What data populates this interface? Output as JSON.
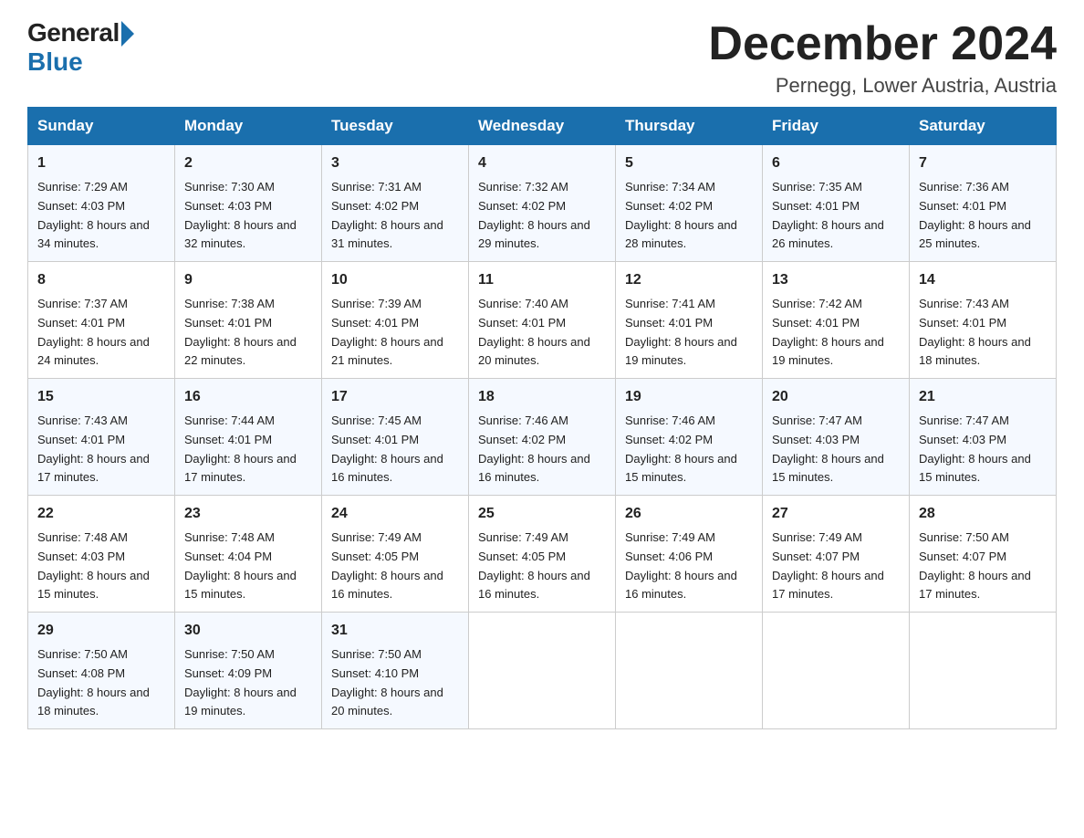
{
  "logo": {
    "general": "General",
    "blue": "Blue"
  },
  "title": "December 2024",
  "location": "Pernegg, Lower Austria, Austria",
  "days_of_week": [
    "Sunday",
    "Monday",
    "Tuesday",
    "Wednesday",
    "Thursday",
    "Friday",
    "Saturday"
  ],
  "weeks": [
    [
      {
        "day": 1,
        "sunrise": "7:29 AM",
        "sunset": "4:03 PM",
        "daylight": "8 hours and 34 minutes."
      },
      {
        "day": 2,
        "sunrise": "7:30 AM",
        "sunset": "4:03 PM",
        "daylight": "8 hours and 32 minutes."
      },
      {
        "day": 3,
        "sunrise": "7:31 AM",
        "sunset": "4:02 PM",
        "daylight": "8 hours and 31 minutes."
      },
      {
        "day": 4,
        "sunrise": "7:32 AM",
        "sunset": "4:02 PM",
        "daylight": "8 hours and 29 minutes."
      },
      {
        "day": 5,
        "sunrise": "7:34 AM",
        "sunset": "4:02 PM",
        "daylight": "8 hours and 28 minutes."
      },
      {
        "day": 6,
        "sunrise": "7:35 AM",
        "sunset": "4:01 PM",
        "daylight": "8 hours and 26 minutes."
      },
      {
        "day": 7,
        "sunrise": "7:36 AM",
        "sunset": "4:01 PM",
        "daylight": "8 hours and 25 minutes."
      }
    ],
    [
      {
        "day": 8,
        "sunrise": "7:37 AM",
        "sunset": "4:01 PM",
        "daylight": "8 hours and 24 minutes."
      },
      {
        "day": 9,
        "sunrise": "7:38 AM",
        "sunset": "4:01 PM",
        "daylight": "8 hours and 22 minutes."
      },
      {
        "day": 10,
        "sunrise": "7:39 AM",
        "sunset": "4:01 PM",
        "daylight": "8 hours and 21 minutes."
      },
      {
        "day": 11,
        "sunrise": "7:40 AM",
        "sunset": "4:01 PM",
        "daylight": "8 hours and 20 minutes."
      },
      {
        "day": 12,
        "sunrise": "7:41 AM",
        "sunset": "4:01 PM",
        "daylight": "8 hours and 19 minutes."
      },
      {
        "day": 13,
        "sunrise": "7:42 AM",
        "sunset": "4:01 PM",
        "daylight": "8 hours and 19 minutes."
      },
      {
        "day": 14,
        "sunrise": "7:43 AM",
        "sunset": "4:01 PM",
        "daylight": "8 hours and 18 minutes."
      }
    ],
    [
      {
        "day": 15,
        "sunrise": "7:43 AM",
        "sunset": "4:01 PM",
        "daylight": "8 hours and 17 minutes."
      },
      {
        "day": 16,
        "sunrise": "7:44 AM",
        "sunset": "4:01 PM",
        "daylight": "8 hours and 17 minutes."
      },
      {
        "day": 17,
        "sunrise": "7:45 AM",
        "sunset": "4:01 PM",
        "daylight": "8 hours and 16 minutes."
      },
      {
        "day": 18,
        "sunrise": "7:46 AM",
        "sunset": "4:02 PM",
        "daylight": "8 hours and 16 minutes."
      },
      {
        "day": 19,
        "sunrise": "7:46 AM",
        "sunset": "4:02 PM",
        "daylight": "8 hours and 15 minutes."
      },
      {
        "day": 20,
        "sunrise": "7:47 AM",
        "sunset": "4:03 PM",
        "daylight": "8 hours and 15 minutes."
      },
      {
        "day": 21,
        "sunrise": "7:47 AM",
        "sunset": "4:03 PM",
        "daylight": "8 hours and 15 minutes."
      }
    ],
    [
      {
        "day": 22,
        "sunrise": "7:48 AM",
        "sunset": "4:03 PM",
        "daylight": "8 hours and 15 minutes."
      },
      {
        "day": 23,
        "sunrise": "7:48 AM",
        "sunset": "4:04 PM",
        "daylight": "8 hours and 15 minutes."
      },
      {
        "day": 24,
        "sunrise": "7:49 AM",
        "sunset": "4:05 PM",
        "daylight": "8 hours and 16 minutes."
      },
      {
        "day": 25,
        "sunrise": "7:49 AM",
        "sunset": "4:05 PM",
        "daylight": "8 hours and 16 minutes."
      },
      {
        "day": 26,
        "sunrise": "7:49 AM",
        "sunset": "4:06 PM",
        "daylight": "8 hours and 16 minutes."
      },
      {
        "day": 27,
        "sunrise": "7:49 AM",
        "sunset": "4:07 PM",
        "daylight": "8 hours and 17 minutes."
      },
      {
        "day": 28,
        "sunrise": "7:50 AM",
        "sunset": "4:07 PM",
        "daylight": "8 hours and 17 minutes."
      }
    ],
    [
      {
        "day": 29,
        "sunrise": "7:50 AM",
        "sunset": "4:08 PM",
        "daylight": "8 hours and 18 minutes."
      },
      {
        "day": 30,
        "sunrise": "7:50 AM",
        "sunset": "4:09 PM",
        "daylight": "8 hours and 19 minutes."
      },
      {
        "day": 31,
        "sunrise": "7:50 AM",
        "sunset": "4:10 PM",
        "daylight": "8 hours and 20 minutes."
      },
      null,
      null,
      null,
      null
    ]
  ]
}
